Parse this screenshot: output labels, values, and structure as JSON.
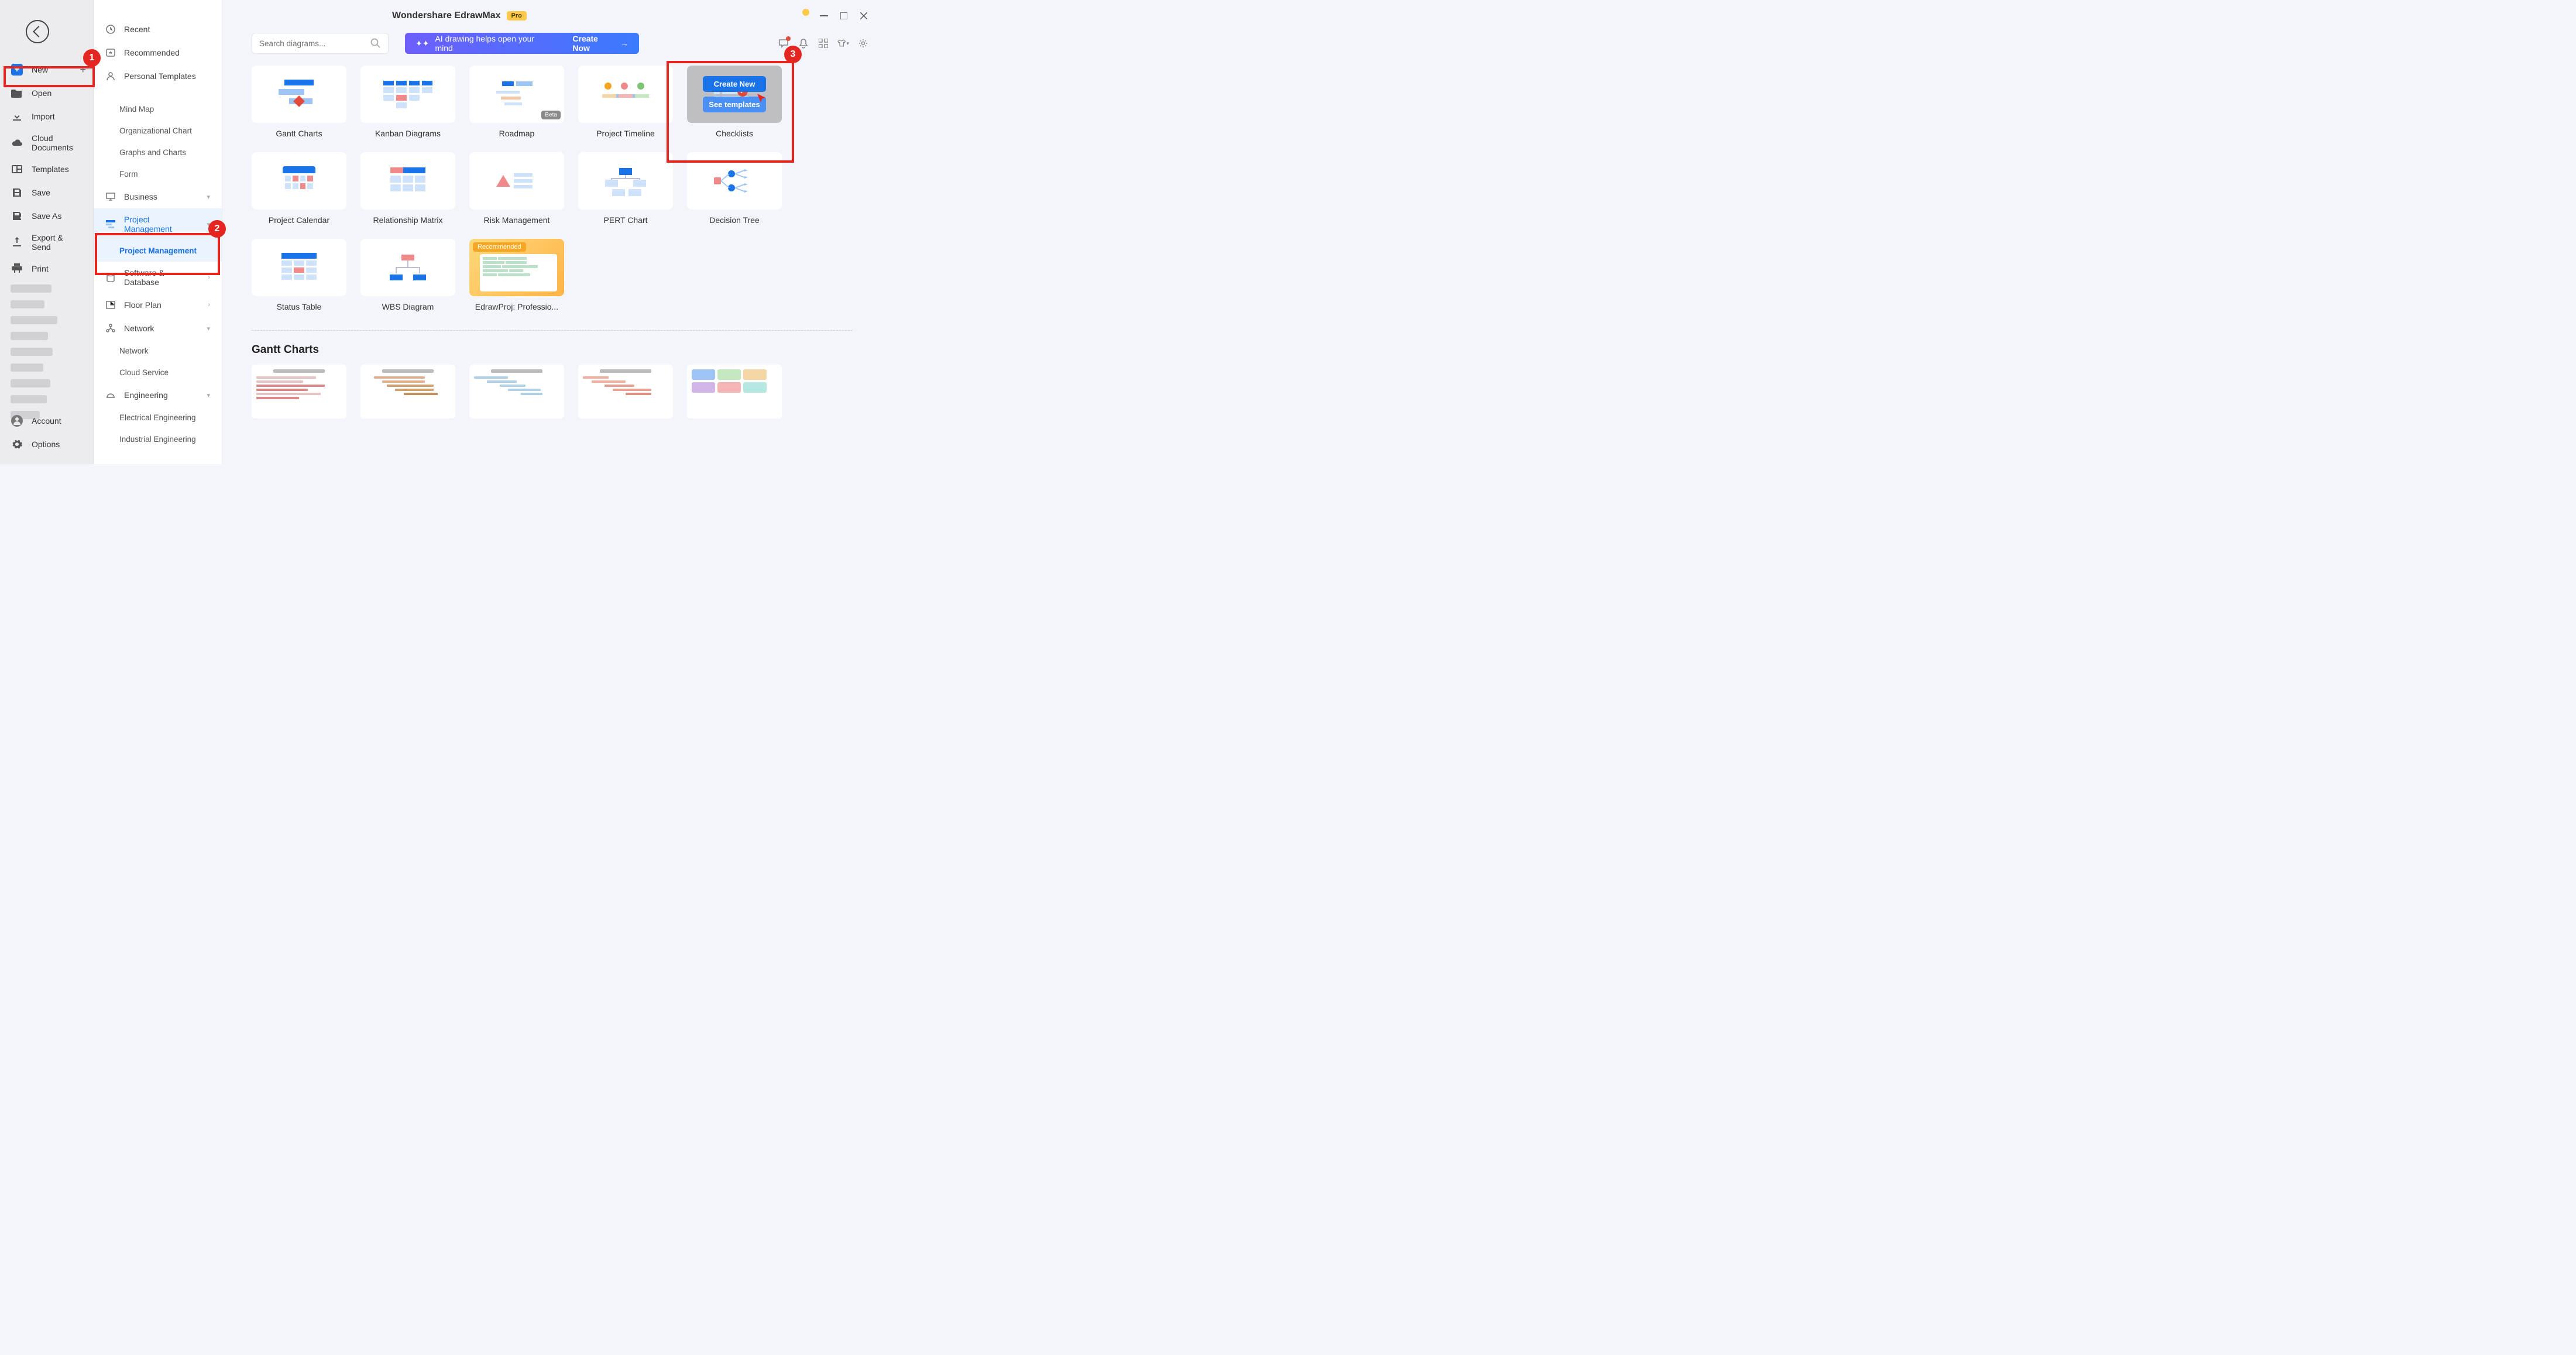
{
  "app": {
    "title": "Wondershare EdrawMax",
    "badge": "Pro"
  },
  "search": {
    "placeholder": "Search diagrams..."
  },
  "ai_banner": {
    "text": "AI drawing helps open your mind",
    "cta": "Create Now"
  },
  "sidebar1": {
    "new": "New",
    "open": "Open",
    "import": "Import",
    "cloud": "Cloud Documents",
    "templates": "Templates",
    "save": "Save",
    "saveas": "Save As",
    "export": "Export & Send",
    "print": "Print",
    "account": "Account",
    "options": "Options"
  },
  "sidebar2": {
    "recent": "Recent",
    "recommended": "Recommended",
    "personal": "Personal Templates",
    "mindmap": "Mind Map",
    "orgchart": "Organizational Chart",
    "graphs": "Graphs and Charts",
    "form": "Form",
    "business": "Business",
    "projmgmt": "Project Management",
    "projmgmt_sub": "Project Management",
    "software": "Software & Database",
    "floorplan": "Floor Plan",
    "network": "Network",
    "network_sub": "Network",
    "cloud_sub": "Cloud Service",
    "engineering": "Engineering",
    "elec": "Electrical Engineering",
    "industrial": "Industrial Engineering"
  },
  "templates": [
    {
      "label": "Gantt Charts",
      "id": "gantt"
    },
    {
      "label": "Kanban Diagrams",
      "id": "kanban"
    },
    {
      "label": "Roadmap",
      "id": "roadmap",
      "badge": "Beta"
    },
    {
      "label": "Project Timeline",
      "id": "timeline"
    },
    {
      "label": "Checklists",
      "id": "checklist",
      "hovered": true
    },
    {
      "label": "Project Calendar",
      "id": "calendar"
    },
    {
      "label": "Relationship Matrix",
      "id": "relmat"
    },
    {
      "label": "Risk Management",
      "id": "risk"
    },
    {
      "label": "PERT Chart",
      "id": "pert"
    },
    {
      "label": "Decision Tree",
      "id": "decision"
    },
    {
      "label": "Status Table",
      "id": "status"
    },
    {
      "label": "WBS Diagram",
      "id": "wbs"
    },
    {
      "label": "EdrawProj: Professio...",
      "id": "edrawproj",
      "recommended": "Recommended"
    }
  ],
  "hover_overlay": {
    "create": "Create New",
    "see": "See templates"
  },
  "section2_title": "Gantt Charts",
  "annotations": {
    "1": "1",
    "2": "2",
    "3": "3"
  }
}
